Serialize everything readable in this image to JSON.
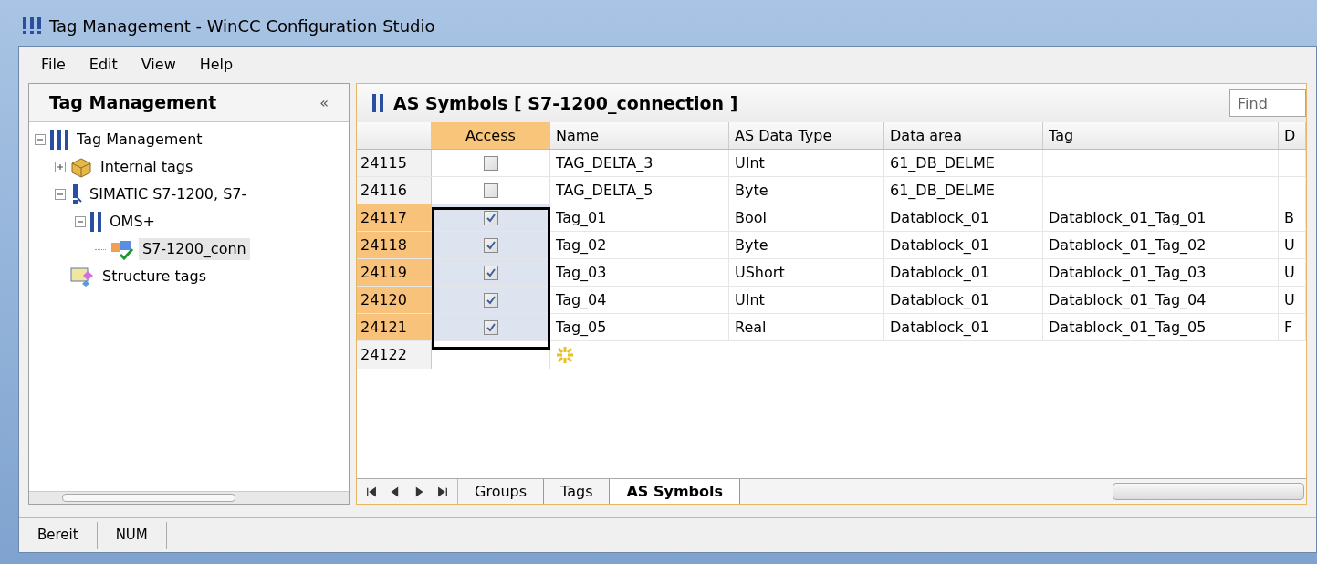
{
  "window": {
    "title": "Tag Management - WinCC Configuration Studio"
  },
  "menu": [
    "File",
    "Edit",
    "View",
    "Help"
  ],
  "navigation": {
    "title": "Tag Management",
    "collapse_glyph": "«",
    "tree": [
      {
        "label": "Tag Management",
        "kind": "root",
        "expanded": true,
        "selected": false,
        "children": [
          {
            "label": "Internal tags",
            "kind": "internal",
            "expanded": false,
            "selected": false
          },
          {
            "label": "SIMATIC S7-1200, S7-",
            "kind": "driver",
            "expanded": true,
            "selected": false,
            "children": [
              {
                "label": "OMS+",
                "kind": "channel",
                "expanded": true,
                "selected": false,
                "children": [
                  {
                    "label": "S7-1200_conn",
                    "kind": "connection",
                    "selected": true
                  }
                ]
              }
            ]
          },
          {
            "label": "Structure tags",
            "kind": "structure",
            "selected": false
          }
        ]
      }
    ]
  },
  "editor": {
    "title": "AS Symbols [ S7-1200_connection ]",
    "find_placeholder": "Find",
    "access_header": "Access",
    "columns": [
      "Name",
      "AS Data Type",
      "Data area",
      "Tag",
      "D"
    ],
    "rows": [
      {
        "number": "24115",
        "checked": false,
        "selected": false,
        "cells": [
          "TAG_DELTA_3",
          "UInt",
          "61_DB_DELME",
          "",
          ""
        ]
      },
      {
        "number": "24116",
        "checked": false,
        "selected": false,
        "cells": [
          "TAG_DELTA_5",
          "Byte",
          "61_DB_DELME",
          "",
          ""
        ]
      },
      {
        "number": "24117",
        "checked": true,
        "selected": true,
        "cells": [
          "Tag_01",
          "Bool",
          "Datablock_01",
          "Datablock_01_Tag_01",
          "B"
        ]
      },
      {
        "number": "24118",
        "checked": true,
        "selected": true,
        "cells": [
          "Tag_02",
          "Byte",
          "Datablock_01",
          "Datablock_01_Tag_02",
          "U"
        ]
      },
      {
        "number": "24119",
        "checked": true,
        "selected": true,
        "cells": [
          "Tag_03",
          "UShort",
          "Datablock_01",
          "Datablock_01_Tag_03",
          "U"
        ]
      },
      {
        "number": "24120",
        "checked": true,
        "selected": true,
        "cells": [
          "Tag_04",
          "UInt",
          "Datablock_01",
          "Datablock_01_Tag_04",
          "U"
        ]
      },
      {
        "number": "24121",
        "checked": true,
        "selected": true,
        "cells": [
          "Tag_05",
          "Real",
          "Datablock_01",
          "Datablock_01_Tag_05",
          "F"
        ]
      }
    ],
    "new_row": {
      "number": "24122"
    },
    "sheet_tabs": [
      {
        "label": "Groups",
        "selected": false
      },
      {
        "label": "Tags",
        "selected": false
      },
      {
        "label": "AS Symbols",
        "selected": true
      }
    ]
  },
  "status_bar": [
    "Bereit",
    "NUM"
  ]
}
